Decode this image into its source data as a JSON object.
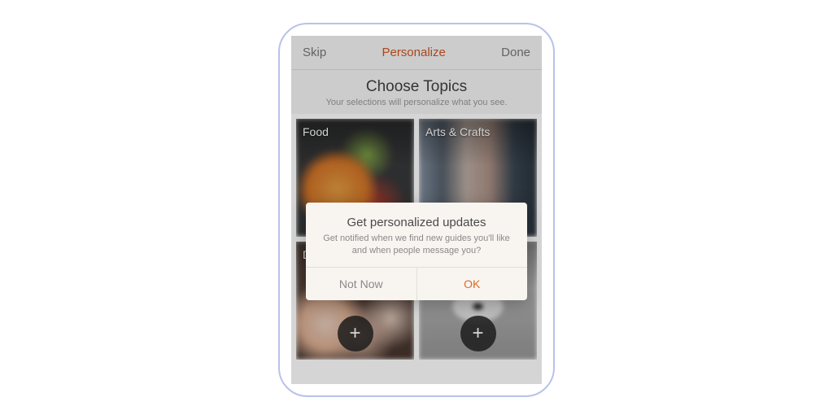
{
  "topbar": {
    "skip_label": "Skip",
    "title": "Personalize",
    "done_label": "Done"
  },
  "header": {
    "title": "Choose Topics",
    "subtitle": "Your selections will personalize what you see."
  },
  "topics": [
    {
      "label": "Food"
    },
    {
      "label": "Arts & Crafts"
    },
    {
      "label": "D"
    },
    {
      "label": ""
    }
  ],
  "modal": {
    "title": "Get personalized updates",
    "body": "Get notified when we find new guides you'll like and when people message you?",
    "not_now_label": "Not Now",
    "ok_label": "OK"
  },
  "icons": {
    "plus": "+"
  },
  "colors": {
    "accent": "#d96a2b",
    "frame_border": "#b9c2e8"
  }
}
